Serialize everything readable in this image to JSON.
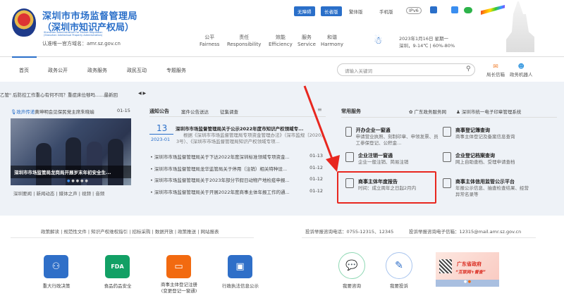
{
  "header": {
    "title_line1": "深圳市市场监督管理局",
    "title_line2": "（深圳市知识产权局）",
    "english_line1": "Shenzhen Administration For Market Regulation",
    "english_line2": "(Shenzhen Intellectual Property Administration)",
    "domain_note": "认准唯一官方域名：amr.sz.gov.cn",
    "toolbar": {
      "accessible": "无障碍",
      "elder": "长者版",
      "traditional": "繁体版",
      "mobile": "手机版",
      "ipv6": "IPv6"
    },
    "values": [
      {
        "zh": "公平",
        "en": "Fairness"
      },
      {
        "zh": "责任",
        "en": "Responsibility"
      },
      {
        "zh": "效能",
        "en": "Efficiency"
      },
      {
        "zh": "服务",
        "en": "Service"
      },
      {
        "zh": "和谐",
        "en": "Harmony"
      }
    ],
    "date": "2023年1月16日 星期一",
    "weather": "深圳，9-14℃  |  60%-80%"
  },
  "nav": {
    "items": [
      "首页",
      "政务公开",
      "政务服务",
      "政民互动",
      "专题服务"
    ],
    "search_placeholder": "请输入关键词",
    "mailbox": "局长信箱",
    "robot": "政务机器人"
  },
  "ticker": {
    "text": "乙管\" 后防控工作重心有何不同？重症床位够吗......最新回"
  },
  "news": {
    "headline_label": "政声传递",
    "headline": "黄坤明会见保民党主席朱晓瑜",
    "headline_date": "01-15",
    "photo_caption": "深圳市市场监管局龙岗局开展岁末年初安全生...",
    "tabs": [
      "深圳要闻",
      "新闻动态",
      "媒体之声",
      "视频",
      "音频"
    ]
  },
  "notices": {
    "tabs": [
      "通知公告",
      "案件公告送达",
      "征集调查"
    ],
    "featured": {
      "day": "13",
      "month": "2023-01",
      "title": "深圳市市场监督管理局关于公示2022年度市知识产权领域专...",
      "summary": "根据《深圳市市场监督管理局专项资金管理办法》（深市监规〔2020〕3号）、《深圳市市场监督管理局知识产权领域专项..."
    },
    "items": [
      {
        "title": "深圳市市场监督管理局关于下达2022年度深圳标准领域专项资金...",
        "date": "01-13"
      },
      {
        "title": "深圳市市场监督管理局龙华监管局关于停用（注销）相关特种设...",
        "date": "01-12"
      },
      {
        "title": "深圳市市场监督管理局关于2023年部分节假日动物产地检疫申报...",
        "date": "01-12"
      },
      {
        "title": "深圳市市场监督管理局关于开展2022年度商事主体年报工作的通...",
        "date": "01-12"
      }
    ]
  },
  "services": {
    "title": "常用服务",
    "link1": "广东政务服务网",
    "link2": "深圳市统一电子印章管理系统",
    "items": [
      {
        "title": "开办企业一窗通",
        "desc": "申请营业执照、刻制印章、申领发票、员工参保登记、公积金..."
      },
      {
        "title": "商事登记簿查询",
        "desc": "商事主体登记及备案信息查询"
      },
      {
        "title": "企业注销一窗通",
        "desc": "企业一般注销、简易注销"
      },
      {
        "title": "企业登记档案查询",
        "desc": "网上自助查档、受理申请查档"
      },
      {
        "title": "商事主体年度报告",
        "desc": "时间：成立周年之日起2月内"
      },
      {
        "title": "商事主体信用监管公示平台",
        "desc": "年报公示信息、抽查检查结果、经营异常名录等"
      }
    ]
  },
  "footer": {
    "links": [
      "政策解读",
      "规范性文件",
      "知识产权维权指引",
      "招标采购",
      "数据开放",
      "政策推送",
      "网站报表"
    ],
    "phone": "投诉举报咨询电话：0755-12315、12345",
    "email": "投诉举报咨询电子信箱：12315@mail.amr.sz.gov.cn",
    "apps": [
      "重大行政决策",
      "食品药品安全",
      "商事主体登记注册",
      "(变更登记一窗通)",
      "行政执法信息公示"
    ],
    "consult": "我要咨询",
    "complain": "我要投诉",
    "banner_title": "广东省政府",
    "banner_sub": "“互联网+督查”"
  },
  "colors": {
    "brand": "#2a6fc9",
    "highlight": "#e8271f"
  }
}
